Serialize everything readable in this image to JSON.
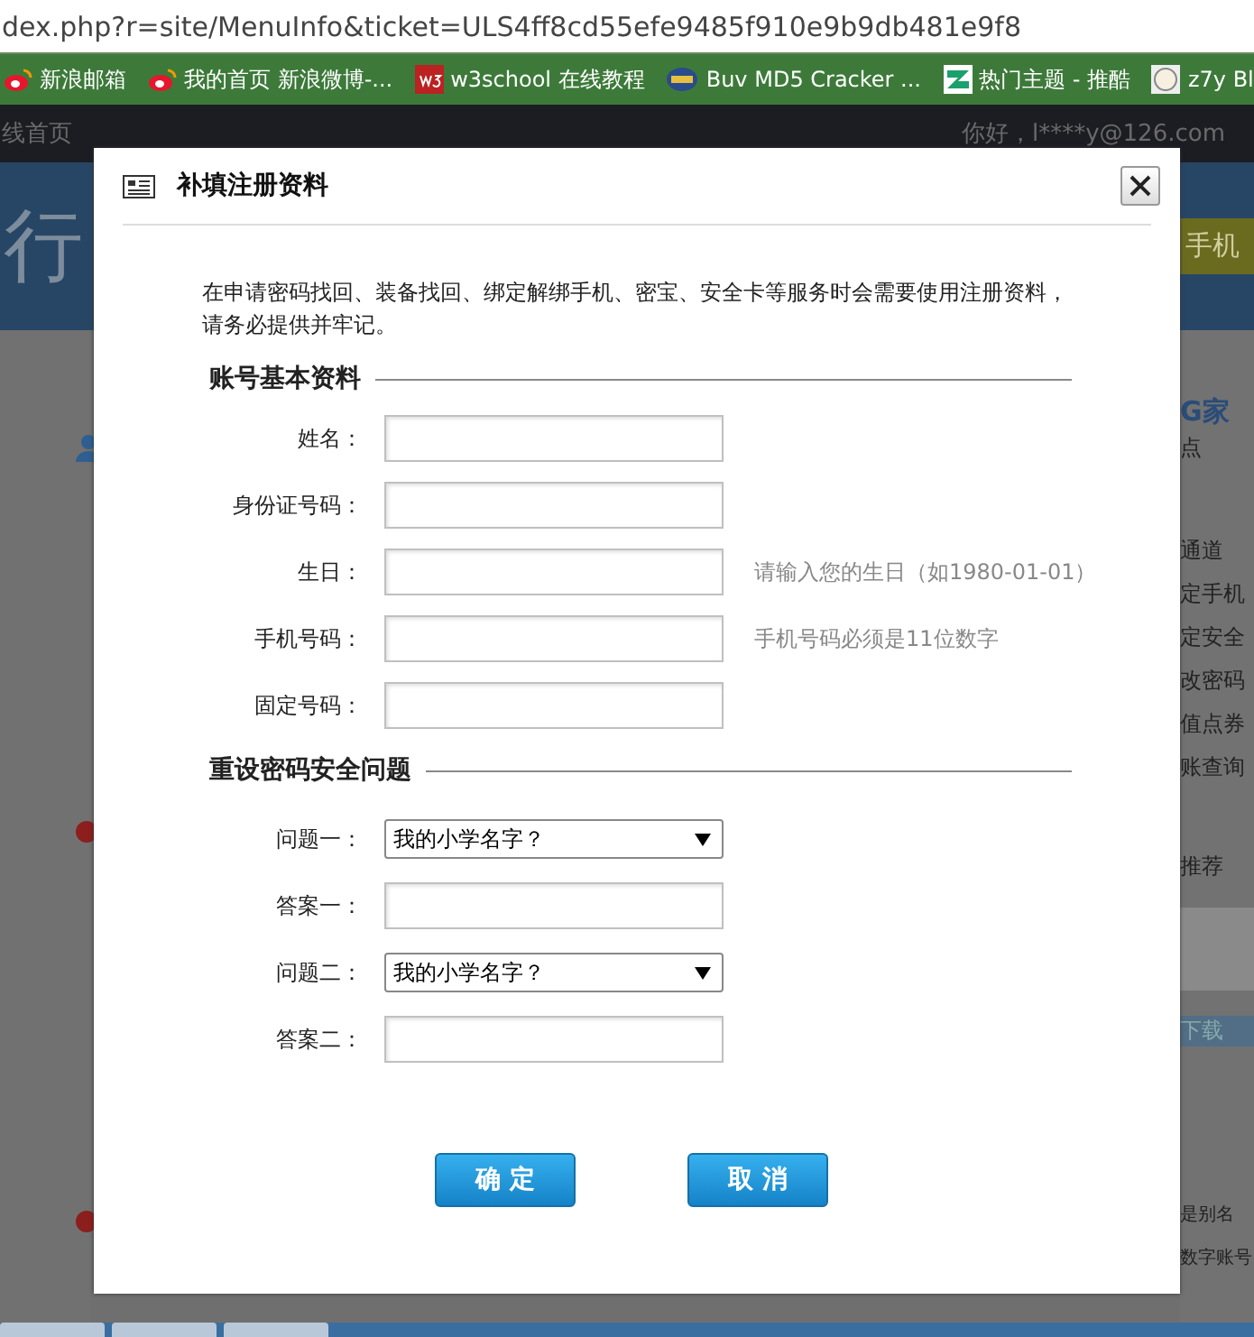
{
  "address_bar": {
    "url": "dex.php?r=site/MenuInfo&ticket=ULS4ff8cd55efe9485f910e9b9db481e9f8"
  },
  "bookmarks": [
    {
      "kind": "weibo",
      "label": "新浪邮箱"
    },
    {
      "kind": "weibo",
      "label": "我的首页 新浪微博-..."
    },
    {
      "kind": "w3",
      "label": "w3school 在线教程"
    },
    {
      "kind": "md5",
      "label": "Buv MD5 Cracker ..."
    },
    {
      "kind": "tui",
      "label": "热门主题 - 推酷"
    },
    {
      "kind": "face",
      "label": "z7y Bl"
    }
  ],
  "top_nav": {
    "home": "线首页",
    "greeting": "你好，l****y@126.com"
  },
  "background": {
    "banner_text": "行",
    "banner_button": "手机",
    "side_title": "G家",
    "side_sub": "点",
    "side_links": [
      "通道",
      "定手机",
      "定安全",
      "改密码",
      "值点券",
      "账查询"
    ],
    "side_heading": "推荐",
    "download": "下载",
    "notes": [
      "是别名",
      "数字账号"
    ]
  },
  "dialog": {
    "title": "补填注册资料",
    "intro": "在申请密码找回、装备找回、绑定解绑手机、密宝、安全卡等服务时会需要使用注册资料，请务必提供并牢记。",
    "sections": [
      {
        "heading": "账号基本资料",
        "fields": [
          {
            "kind": "text",
            "label": "姓名："
          },
          {
            "kind": "text",
            "label": "身份证号码："
          },
          {
            "kind": "text",
            "label": "生日：",
            "hint": "请输入您的生日（如1980-01-01）"
          },
          {
            "kind": "text",
            "label": "手机号码：",
            "hint": "手机号码必须是11位数字"
          },
          {
            "kind": "text",
            "label": "固定号码："
          }
        ]
      },
      {
        "heading": "重设密码安全问题",
        "fields": [
          {
            "kind": "select",
            "label": "问题一：",
            "value": "我的小学名字？"
          },
          {
            "kind": "text",
            "label": "答案一："
          },
          {
            "kind": "select",
            "label": "问题二：",
            "value": "我的小学名字？"
          },
          {
            "kind": "text",
            "label": "答案二："
          }
        ]
      }
    ],
    "buttons": [
      {
        "label": "确 定"
      },
      {
        "label": "取 消"
      }
    ]
  }
}
